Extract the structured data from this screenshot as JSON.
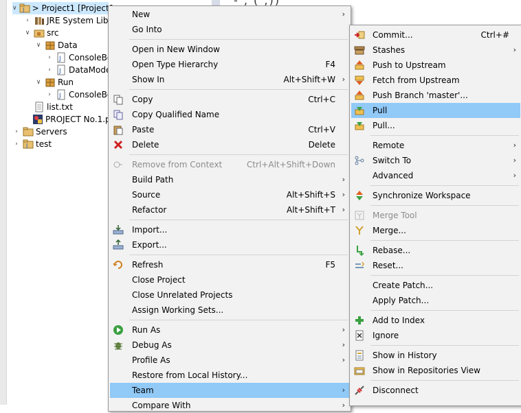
{
  "tree": [
    {
      "label": "> Project1 [Project1",
      "twisty": "open"
    },
    {
      "label": "JRE System Libra",
      "twisty": "closed"
    },
    {
      "label": "src",
      "twisty": "open"
    },
    {
      "label": "Data",
      "twisty": "open"
    },
    {
      "label": "ConsoleBo",
      "twisty": "closed"
    },
    {
      "label": "DataMode",
      "twisty": "closed"
    },
    {
      "label": "Run",
      "twisty": "open"
    },
    {
      "label": "ConsoleBo",
      "twisty": "closed"
    },
    {
      "label": "list.txt",
      "twisty": ""
    },
    {
      "label": "PROJECT No.1.p",
      "twisty": ""
    },
    {
      "label": "Servers",
      "twisty": "closed"
    },
    {
      "label": "test",
      "twisty": "closed"
    }
  ],
  "editor_snippet": "-   ,  (  ,))",
  "context_menu": [
    {
      "label": "New",
      "shortcut": "",
      "arrow": true
    },
    {
      "label": "Go Into",
      "shortcut": "",
      "arrow": false
    },
    {
      "label": "Open in New Window",
      "shortcut": "",
      "arrow": false
    },
    {
      "label": "Open Type Hierarchy",
      "shortcut": "F4",
      "arrow": false
    },
    {
      "label": "Show In",
      "shortcut": "Alt+Shift+W",
      "arrow": true
    },
    {
      "label": "Copy",
      "shortcut": "Ctrl+C",
      "arrow": false,
      "icon": "copy-icon"
    },
    {
      "label": "Copy Qualified Name",
      "shortcut": "",
      "arrow": false,
      "icon": "copy-qualified-name-icon"
    },
    {
      "label": "Paste",
      "shortcut": "Ctrl+V",
      "arrow": false,
      "icon": "paste-icon"
    },
    {
      "label": "Delete",
      "shortcut": "Delete",
      "arrow": false,
      "icon": "delete-icon"
    },
    {
      "label": "Remove from Context",
      "shortcut": "Ctrl+Alt+Shift+Down",
      "arrow": false,
      "disabled": true,
      "icon": "remove-context-icon"
    },
    {
      "label": "Build Path",
      "shortcut": "",
      "arrow": true
    },
    {
      "label": "Source",
      "shortcut": "Alt+Shift+S",
      "arrow": true
    },
    {
      "label": "Refactor",
      "shortcut": "Alt+Shift+T",
      "arrow": true
    },
    {
      "label": "Import...",
      "shortcut": "",
      "arrow": false,
      "icon": "import-icon"
    },
    {
      "label": "Export...",
      "shortcut": "",
      "arrow": false,
      "icon": "export-icon"
    },
    {
      "label": "Refresh",
      "shortcut": "F5",
      "arrow": false,
      "icon": "refresh-icon"
    },
    {
      "label": "Close Project",
      "shortcut": "",
      "arrow": false
    },
    {
      "label": "Close Unrelated Projects",
      "shortcut": "",
      "arrow": false
    },
    {
      "label": "Assign Working Sets...",
      "shortcut": "",
      "arrow": false
    },
    {
      "label": "Run As",
      "shortcut": "",
      "arrow": true,
      "icon": "run-icon"
    },
    {
      "label": "Debug As",
      "shortcut": "",
      "arrow": true,
      "icon": "debug-icon"
    },
    {
      "label": "Profile As",
      "shortcut": "",
      "arrow": true
    },
    {
      "label": "Restore from Local History...",
      "shortcut": "",
      "arrow": false
    },
    {
      "label": "Team",
      "shortcut": "",
      "arrow": true,
      "highlighted": true
    },
    {
      "label": "Compare With",
      "shortcut": "",
      "arrow": true
    }
  ],
  "team_menu": [
    {
      "label": "Commit...",
      "shortcut": "Ctrl+#",
      "arrow": false,
      "icon": "commit-icon"
    },
    {
      "label": "Stashes",
      "shortcut": "",
      "arrow": true,
      "icon": "stashes-icon"
    },
    {
      "label": "Push to Upstream",
      "shortcut": "",
      "arrow": false,
      "icon": "push-upstream-icon"
    },
    {
      "label": "Fetch from Upstream",
      "shortcut": "",
      "arrow": false,
      "icon": "fetch-upstream-icon"
    },
    {
      "label": "Push Branch 'master'...",
      "shortcut": "",
      "arrow": false,
      "icon": "push-branch-icon"
    },
    {
      "label": "Pull",
      "shortcut": "",
      "arrow": false,
      "icon": "pull-icon",
      "highlighted": true
    },
    {
      "label": "Pull...",
      "shortcut": "",
      "arrow": false,
      "icon": "pull-dialog-icon"
    },
    {
      "label": "Remote",
      "shortcut": "",
      "arrow": true
    },
    {
      "label": "Switch To",
      "shortcut": "",
      "arrow": true,
      "icon": "switch-branch-icon"
    },
    {
      "label": "Advanced",
      "shortcut": "",
      "arrow": true
    },
    {
      "label": "Synchronize Workspace",
      "shortcut": "",
      "arrow": false,
      "icon": "synchronize-icon"
    },
    {
      "label": "Merge Tool",
      "shortcut": "",
      "arrow": false,
      "disabled": true,
      "icon": "merge-tool-icon"
    },
    {
      "label": "Merge...",
      "shortcut": "",
      "arrow": false,
      "icon": "merge-icon"
    },
    {
      "label": "Rebase...",
      "shortcut": "",
      "arrow": false,
      "icon": "rebase-icon"
    },
    {
      "label": "Reset...",
      "shortcut": "",
      "arrow": false,
      "icon": "reset-icon"
    },
    {
      "label": "Create Patch...",
      "shortcut": "",
      "arrow": false
    },
    {
      "label": "Apply Patch...",
      "shortcut": "",
      "arrow": false
    },
    {
      "label": "Add to Index",
      "shortcut": "",
      "arrow": false,
      "icon": "add-index-icon"
    },
    {
      "label": "Ignore",
      "shortcut": "",
      "arrow": false,
      "icon": "ignore-icon"
    },
    {
      "label": "Show in History",
      "shortcut": "",
      "arrow": false,
      "icon": "history-icon"
    },
    {
      "label": "Show in Repositories View",
      "shortcut": "",
      "arrow": false,
      "icon": "repositories-icon"
    },
    {
      "label": "Disconnect",
      "shortcut": "",
      "arrow": false,
      "icon": "disconnect-icon"
    }
  ],
  "colors": {
    "highlight": "#91c9f7",
    "menu_bg": "#f2f2f2",
    "selection": "#cce8ff",
    "disabled": "#8c8c8c"
  }
}
